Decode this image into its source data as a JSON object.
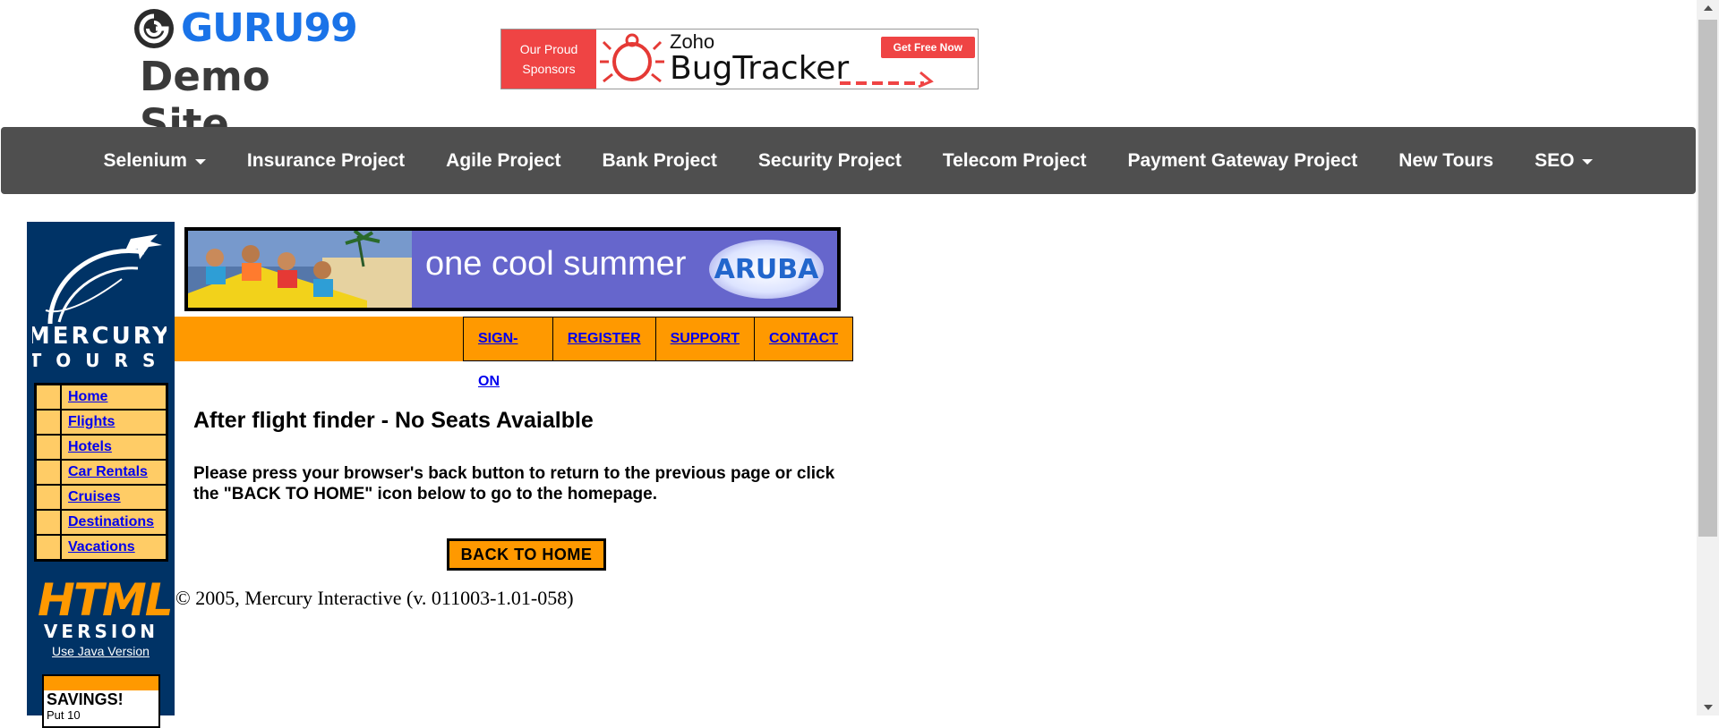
{
  "header": {
    "brand": "GURU99",
    "subtitle": "Demo Site",
    "sponsor": {
      "left_line1": "Our Proud",
      "left_line2": "Sponsors",
      "zoho": "Zoho",
      "product": "BugTracker",
      "cta": "Get Free Now"
    }
  },
  "nav": {
    "items": [
      {
        "label": "Selenium",
        "dropdown": true
      },
      {
        "label": "Insurance Project",
        "dropdown": false
      },
      {
        "label": "Agile Project",
        "dropdown": false
      },
      {
        "label": "Bank Project",
        "dropdown": false
      },
      {
        "label": "Security Project",
        "dropdown": false
      },
      {
        "label": "Telecom Project",
        "dropdown": false
      },
      {
        "label": "Payment Gateway Project",
        "dropdown": false
      },
      {
        "label": "New Tours",
        "dropdown": false
      },
      {
        "label": "SEO",
        "dropdown": true
      }
    ]
  },
  "mercury": {
    "logo_line1": "MERCURY",
    "logo_line2": "TOURS",
    "menu": [
      "Home",
      "Flights",
      "Hotels",
      "Car Rentals",
      "Cruises",
      "Destinations",
      "Vacations"
    ],
    "html_word": "HTML",
    "version_word": "VERSION",
    "java_link": "Use Java Version",
    "savings": "SAVINGS!",
    "savings_sub": "Put 10",
    "banner_text": "one cool summer",
    "banner_logo": "ARUBA",
    "top_links": [
      "SIGN-ON",
      "REGISTER",
      "SUPPORT",
      "CONTACT"
    ],
    "title": "After flight finder - No Seats Avaialble",
    "message": "Please press your browser's back button to return to the previous page or click the \"BACK TO HOME\" icon below to go to the homepage.",
    "back_button": "BACK TO HOME",
    "copyright": "© 2005, Mercury Interactive (v. 011003-1.01-058)"
  },
  "colors": {
    "brand_blue": "#1a73e8",
    "nav_bg": "#4f4f4f",
    "mercury_navy": "#003366",
    "mercury_orange": "#ff9900",
    "menu_tan": "#ffcc66",
    "sponsor_red": "#ef4444"
  }
}
